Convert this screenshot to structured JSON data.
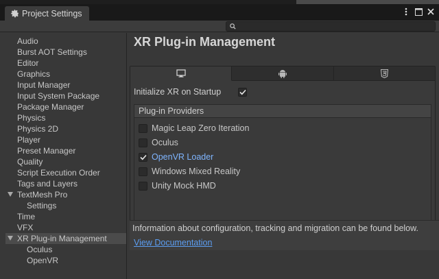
{
  "window": {
    "tab_title": "Project Settings",
    "tab_icon": "gear-icon",
    "controls": [
      "more-options-icon",
      "maximize-icon",
      "close-icon"
    ]
  },
  "search": {
    "placeholder": "",
    "value": ""
  },
  "sidebar": {
    "items": [
      {
        "label": "Audio"
      },
      {
        "label": "Burst AOT Settings"
      },
      {
        "label": "Editor"
      },
      {
        "label": "Graphics"
      },
      {
        "label": "Input Manager"
      },
      {
        "label": "Input System Package"
      },
      {
        "label": "Package Manager"
      },
      {
        "label": "Physics"
      },
      {
        "label": "Physics 2D"
      },
      {
        "label": "Player"
      },
      {
        "label": "Preset Manager"
      },
      {
        "label": "Quality"
      },
      {
        "label": "Script Execution Order"
      },
      {
        "label": "Tags and Layers"
      },
      {
        "label": "TextMesh Pro",
        "expanded": true
      },
      {
        "label": "Settings",
        "child": true
      },
      {
        "label": "Time"
      },
      {
        "label": "VFX"
      },
      {
        "label": "XR Plug-in Management",
        "expanded": true,
        "selected": true
      },
      {
        "label": "Oculus",
        "child": true
      },
      {
        "label": "OpenVR",
        "child": true
      }
    ]
  },
  "main": {
    "title": "XR Plug-in Management",
    "platform_tabs": [
      {
        "icon": "desktop-icon",
        "active": true
      },
      {
        "icon": "android-icon",
        "active": false
      },
      {
        "icon": "html5-icon",
        "active": false
      }
    ],
    "init_xr": {
      "label": "Initialize XR on Startup",
      "checked": true
    },
    "providers": {
      "header": "Plug-in Providers",
      "items": [
        {
          "label": "Magic Leap Zero Iteration",
          "checked": false
        },
        {
          "label": "Oculus",
          "checked": false
        },
        {
          "label": "OpenVR Loader",
          "checked": true
        },
        {
          "label": "Windows Mixed Reality",
          "checked": false
        },
        {
          "label": "Unity Mock HMD",
          "checked": false
        }
      ]
    },
    "info": {
      "text": "Information about configuration, tracking and migration can be found below.",
      "link": "View Documentation"
    }
  },
  "colors": {
    "background": "#383838",
    "link": "#5c9ef2",
    "active_provider": "#7fb5ff"
  }
}
